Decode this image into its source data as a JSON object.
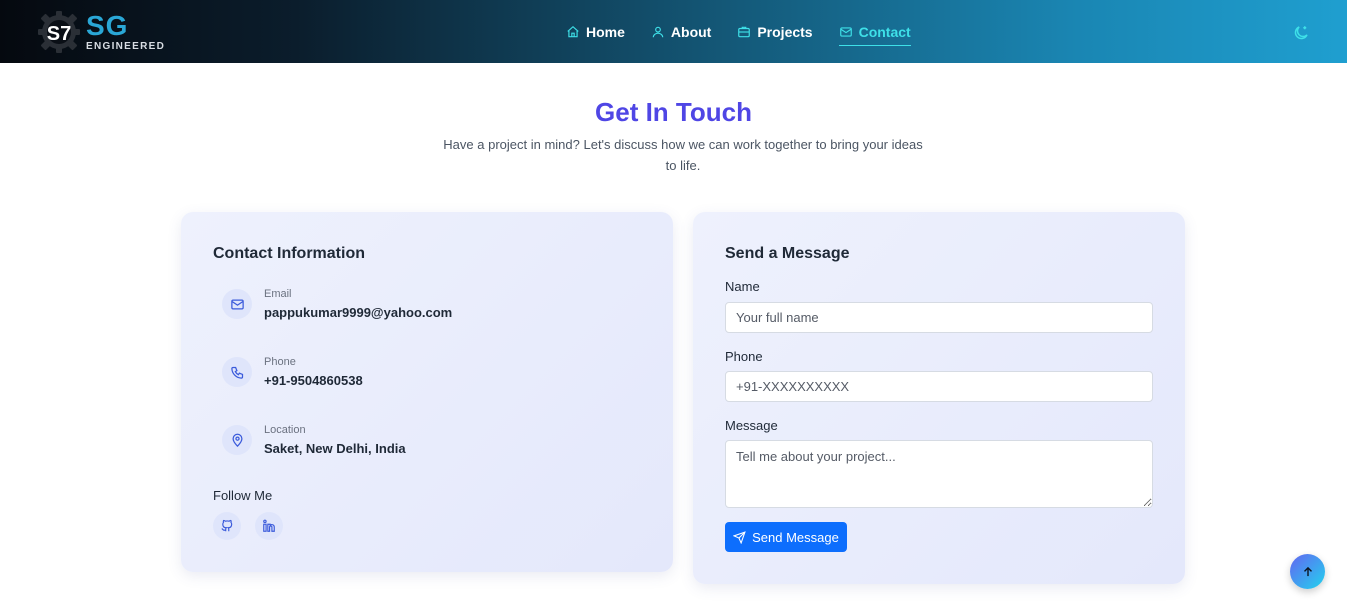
{
  "brand": {
    "logo_mark": "SG-logo-gear",
    "name": "SG",
    "tagline": "ENGINEERED"
  },
  "nav": {
    "items": [
      {
        "label": "Home",
        "icon": "home-icon"
      },
      {
        "label": "About",
        "icon": "user-icon"
      },
      {
        "label": "Projects",
        "icon": "briefcase-icon"
      },
      {
        "label": "Contact",
        "icon": "mail-icon",
        "active": true
      }
    ],
    "theme_toggle_icon": "moon-stars-icon"
  },
  "hero": {
    "title": "Get In Touch",
    "subtitle": "Have a project in mind? Let's discuss how we can work together to bring your ideas to life."
  },
  "contact_info": {
    "title": "Contact Information",
    "items": [
      {
        "label": "Email",
        "value": "pappukumar9999@yahoo.com",
        "icon": "mail-icon"
      },
      {
        "label": "Phone",
        "value": "+91-9504860538",
        "icon": "phone-icon"
      },
      {
        "label": "Location",
        "value": "Saket, New Delhi, India",
        "icon": "map-pin-icon"
      }
    ],
    "follow_label": "Follow Me",
    "socials": [
      {
        "name": "GitHub",
        "icon": "github-icon"
      },
      {
        "name": "LinkedIn",
        "icon": "linkedin-icon"
      }
    ]
  },
  "message_form": {
    "title": "Send a Message",
    "name_label": "Name",
    "name_placeholder": "Your full name",
    "phone_label": "Phone",
    "phone_placeholder": "+91-XXXXXXXXXX",
    "message_label": "Message",
    "message_placeholder": "Tell me about your project...",
    "submit_label": "Send Message"
  },
  "colors": {
    "accent": "#4f46e5",
    "nav_active": "#3ee0e8",
    "button": "#0d6efd"
  }
}
